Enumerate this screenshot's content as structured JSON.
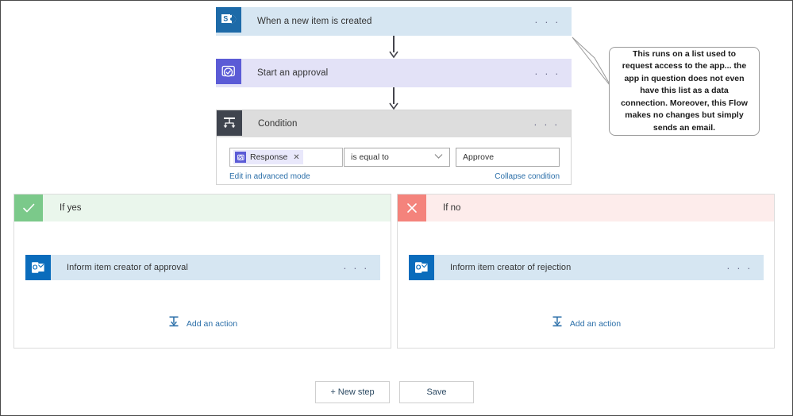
{
  "flow": {
    "trigger": {
      "title": "When a new item is created",
      "icon": "sharepoint-icon",
      "menu": "· · ·",
      "color": "#d6e6f2"
    },
    "approval": {
      "title": "Start an approval",
      "icon": "approvals-icon",
      "menu": "· · ·",
      "color": "#e3e2f7"
    },
    "condition": {
      "title": "Condition",
      "icon": "condition-icon",
      "menu": "· · ·",
      "color": "#dddddd",
      "left_operand": {
        "token_label": "Response",
        "token_remove": "✕",
        "token_icon": "approvals-icon"
      },
      "operator": {
        "value": "is equal to",
        "chevron": "chevron-down-icon"
      },
      "right_operand": {
        "value": "Approve"
      },
      "edit_advanced_link": "Edit in advanced mode",
      "collapse_link": "Collapse condition"
    },
    "branches": [
      {
        "label": "If yes",
        "badge_icon": "checkmark-icon",
        "badge_color": "#7bc98a",
        "header_color": "#eaf6ec",
        "action": {
          "title": "Inform item creator of approval",
          "icon": "outlook-icon",
          "menu": "· · ·",
          "color": "#d6e6f2"
        },
        "add_action_label": "Add an action",
        "add_action_icon": "add-action-icon"
      },
      {
        "label": "If no",
        "badge_icon": "close-icon",
        "badge_color": "#f4837c",
        "header_color": "#fdeceb",
        "action": {
          "title": "Inform item creator of rejection",
          "icon": "outlook-icon",
          "menu": "· · ·",
          "color": "#d6e6f2"
        },
        "add_action_label": "Add an action",
        "add_action_icon": "add-action-icon"
      }
    ]
  },
  "callout": {
    "text": "This runs on a list used to request access to the app... the app in question does not even have this list as a data connection. Moreover, this Flow makes no changes but simply sends an email."
  },
  "footer": {
    "new_step_label": "+ New step",
    "save_label": "Save"
  }
}
